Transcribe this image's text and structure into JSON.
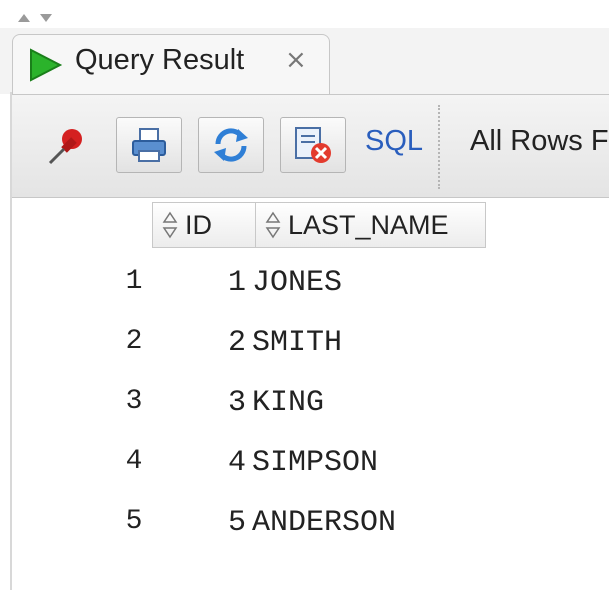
{
  "tab": {
    "title": "Query Result",
    "close_glyph": "×"
  },
  "toolbar": {
    "pin_icon": "pin-icon",
    "print_icon": "print-icon",
    "refresh_icon": "refresh-icon",
    "cancel_icon": "cancel-fetch-icon",
    "sql_label": "SQL",
    "fetch_status": "All Rows F"
  },
  "grid": {
    "columns": [
      "ID",
      "LAST_NAME"
    ],
    "rows": [
      {
        "num": "1",
        "id": "1",
        "last_name": "JONES"
      },
      {
        "num": "2",
        "id": "2",
        "last_name": "SMITH"
      },
      {
        "num": "3",
        "id": "3",
        "last_name": "KING"
      },
      {
        "num": "4",
        "id": "4",
        "last_name": "SIMPSON"
      },
      {
        "num": "5",
        "id": "5",
        "last_name": "ANDERSON"
      }
    ]
  },
  "colors": {
    "play": "#2bb32b",
    "sql_link": "#2a5ebd",
    "pin": "#d42020"
  }
}
